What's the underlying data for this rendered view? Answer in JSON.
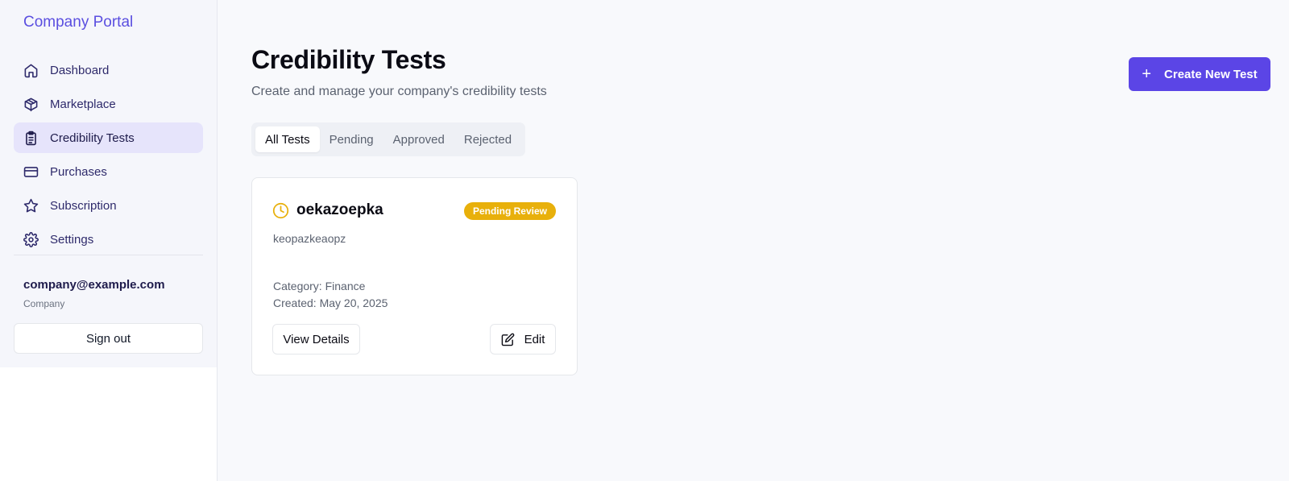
{
  "sidebar": {
    "brand": "Company Portal",
    "items": [
      {
        "label": "Dashboard",
        "icon": "home-icon"
      },
      {
        "label": "Marketplace",
        "icon": "package-icon"
      },
      {
        "label": "Credibility Tests",
        "icon": "clipboard-icon",
        "active": true
      },
      {
        "label": "Purchases",
        "icon": "credit-card-icon"
      },
      {
        "label": "Subscription",
        "icon": "star-icon"
      },
      {
        "label": "Settings",
        "icon": "gear-icon"
      }
    ],
    "user": {
      "email": "company@example.com",
      "role": "Company"
    },
    "signout_label": "Sign out"
  },
  "header": {
    "title": "Credibility Tests",
    "subtitle": "Create and manage your company's credibility tests",
    "create_label": "Create New Test"
  },
  "tabs": [
    {
      "label": "All Tests",
      "active": true
    },
    {
      "label": "Pending"
    },
    {
      "label": "Approved"
    },
    {
      "label": "Rejected"
    }
  ],
  "tests": [
    {
      "title": "oekazoepka",
      "status": "Pending Review",
      "description": "keopazkeaopz",
      "category": "Category: Finance",
      "created": "Created: May 20, 2025",
      "view_label": "View Details",
      "edit_label": "Edit"
    }
  ],
  "colors": {
    "accent": "#5b45e6",
    "brand": "#5b4fe0",
    "pending": "#e8b00b",
    "active_nav_bg": "#e6e4fb"
  }
}
